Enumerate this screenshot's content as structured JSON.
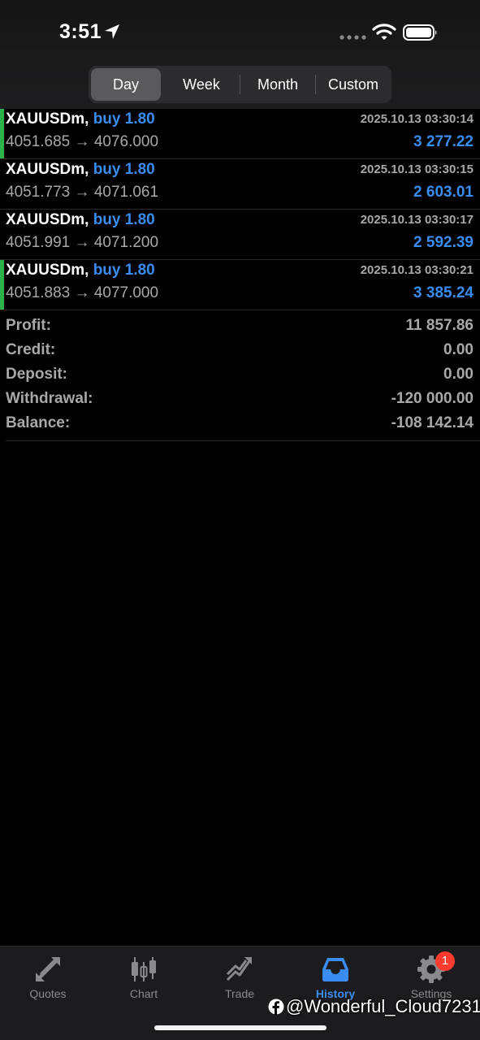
{
  "status_bar": {
    "time": "3:51"
  },
  "period_tabs": [
    {
      "label": "Day",
      "active": true
    },
    {
      "label": "Week",
      "active": false
    },
    {
      "label": "Month",
      "active": false
    },
    {
      "label": "Custom",
      "active": false
    }
  ],
  "deals": [
    {
      "symbol": "XAUUSDm",
      "separator": ",",
      "action": "buy",
      "volume": "1.80",
      "time": "2025.10.13 03:30:14",
      "open_price": "4051.685",
      "arrow": "→",
      "close_price": "4076.000",
      "profit": "3 277.22",
      "bar_color": "#2bb34a"
    },
    {
      "symbol": "XAUUSDm",
      "separator": ",",
      "action": "buy",
      "volume": "1.80",
      "time": "2025.10.13 03:30:15",
      "open_price": "4051.773",
      "arrow": "→",
      "close_price": "4071.061",
      "profit": "2 603.01",
      "bar_color": ""
    },
    {
      "symbol": "XAUUSDm",
      "separator": ",",
      "action": "buy",
      "volume": "1.80",
      "time": "2025.10.13 03:30:17",
      "open_price": "4051.991",
      "arrow": "→",
      "close_price": "4071.200",
      "profit": "2 592.39",
      "bar_color": ""
    },
    {
      "symbol": "XAUUSDm",
      "separator": ",",
      "action": "buy",
      "volume": "1.80",
      "time": "2025.10.13 03:30:21",
      "open_price": "4051.883",
      "arrow": "→",
      "close_price": "4077.000",
      "profit": "3 385.24",
      "bar_color": "#2bb34a"
    }
  ],
  "summary": [
    {
      "label": "Profit:",
      "value": "11 857.86"
    },
    {
      "label": "Credit:",
      "value": "0.00"
    },
    {
      "label": "Deposit:",
      "value": "0.00"
    },
    {
      "label": "Withdrawal:",
      "value": "-120 000.00"
    },
    {
      "label": "Balance:",
      "value": "-108 142.14"
    }
  ],
  "tab_bar": [
    {
      "label": "Quotes",
      "icon": "quotes-icon",
      "active": false
    },
    {
      "label": "Chart",
      "icon": "chart-icon",
      "active": false
    },
    {
      "label": "Trade",
      "icon": "trade-icon",
      "active": false
    },
    {
      "label": "History",
      "icon": "history-icon",
      "active": true
    },
    {
      "label": "Settings",
      "icon": "settings-icon",
      "active": false,
      "badge": "1"
    }
  ],
  "watermark": {
    "text": "@Wonderful_Cloud7231"
  },
  "colors": {
    "accent": "#3a8cf0",
    "buy_bar": "#2bb34a",
    "muted": "#a8a8a8",
    "badge": "#ff3b30"
  }
}
